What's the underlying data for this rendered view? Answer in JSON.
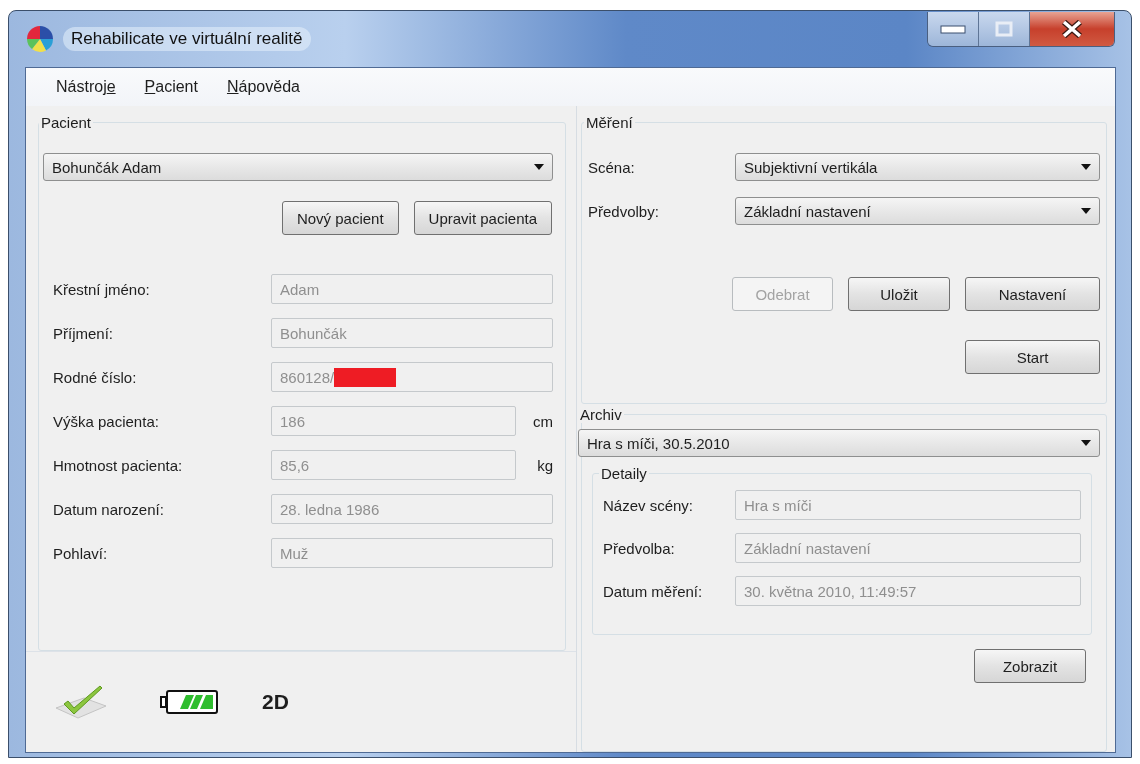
{
  "window": {
    "title": "Rehabilicate ve virtuální realitě"
  },
  "menu": [
    {
      "before": "Nástroj",
      "key": "e"
    },
    {
      "key": "P",
      "after": "acient"
    },
    {
      "key": "N",
      "after": "ápověda"
    }
  ],
  "patient": {
    "group_title": "Pacient",
    "selector": "Bohunčák Adam",
    "buttons": [
      {
        "label": "Nový pacient",
        "disabled": false
      },
      {
        "label": "Upravit pacienta",
        "disabled": false
      }
    ],
    "fields": [
      {
        "label": "Křestní jméno:",
        "value": "Adam",
        "disabled": true
      },
      {
        "label": "Příjmení:",
        "value": "Bohunčák",
        "disabled": true
      },
      {
        "label": "Rodné číslo:",
        "value": "860128/",
        "redacted": true,
        "disabled": true
      },
      {
        "label": "Výška pacienta:",
        "value": "186",
        "unit": "cm",
        "disabled": true
      },
      {
        "label": "Hmotnost pacienta:",
        "value": "85,6",
        "unit": "kg",
        "disabled": true
      },
      {
        "label": "Datum narození:",
        "value": "28. ledna 1986",
        "disabled": true
      },
      {
        "label": "Pohlaví:",
        "value": "Muž",
        "disabled": true
      }
    ]
  },
  "status_bar": {
    "mode": "2D"
  },
  "measurement": {
    "group_title": "Měření",
    "rows": [
      {
        "label": "Scéna:",
        "value": "Subjektivní vertikála"
      },
      {
        "label": "Předvolby:",
        "value": "Základní nastavení"
      }
    ],
    "buttons": [
      {
        "label": "Odebrat",
        "disabled": true
      },
      {
        "label": "Uložit",
        "disabled": false
      },
      {
        "label": "Nastavení",
        "disabled": false
      }
    ],
    "start_button": {
      "label": "Start",
      "disabled": false
    }
  },
  "archive": {
    "group_title": "Archiv",
    "selector": "Hra s míči, 30.5.2010",
    "details": {
      "group_title": "Detaily",
      "fields": [
        {
          "label": "Název scény:",
          "value": "Hra s míči",
          "disabled": true
        },
        {
          "label": "Předvolba:",
          "value": "Základní nastavení",
          "disabled": true
        },
        {
          "label": "Datum měření:",
          "value": "30. května 2010, 11:49:57",
          "disabled": true
        }
      ]
    },
    "show_button": {
      "label": "Zobrazit",
      "disabled": false
    }
  }
}
